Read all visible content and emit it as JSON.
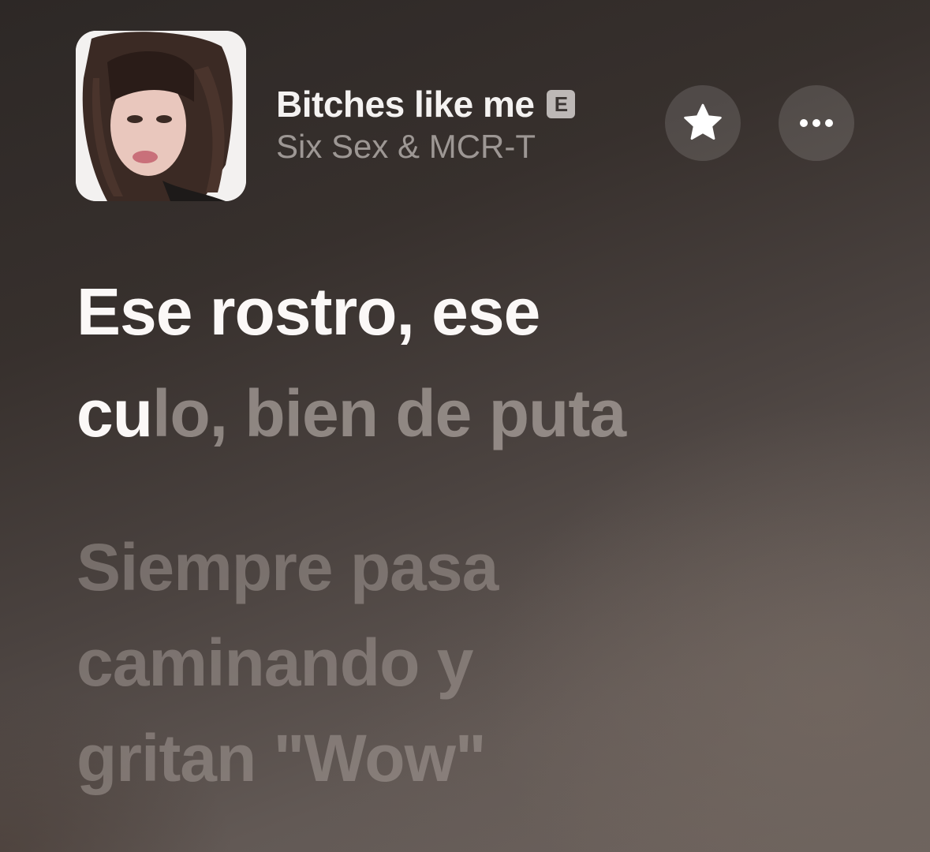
{
  "track": {
    "title": "Bitches like me",
    "explicit_badge": "E",
    "artist": "Six Sex & MCR-T"
  },
  "buttons": {
    "favorite_icon": "star-icon",
    "more_icon": "ellipsis-icon"
  },
  "lyrics": {
    "current_line_1": "Ese rostro, ese",
    "current_line_2_sung": "cu",
    "current_line_2_unsung": "lo, bien de puta",
    "next_line_1": "Siempre pasa",
    "next_line_2": "caminando y",
    "next_line_3": "gritan \"Wow\""
  },
  "colors": {
    "active_lyric": "#fbf8f7",
    "inactive_lyric": "#b9b0ac",
    "artist_text": "#9d9794",
    "background": "#3f3835"
  }
}
